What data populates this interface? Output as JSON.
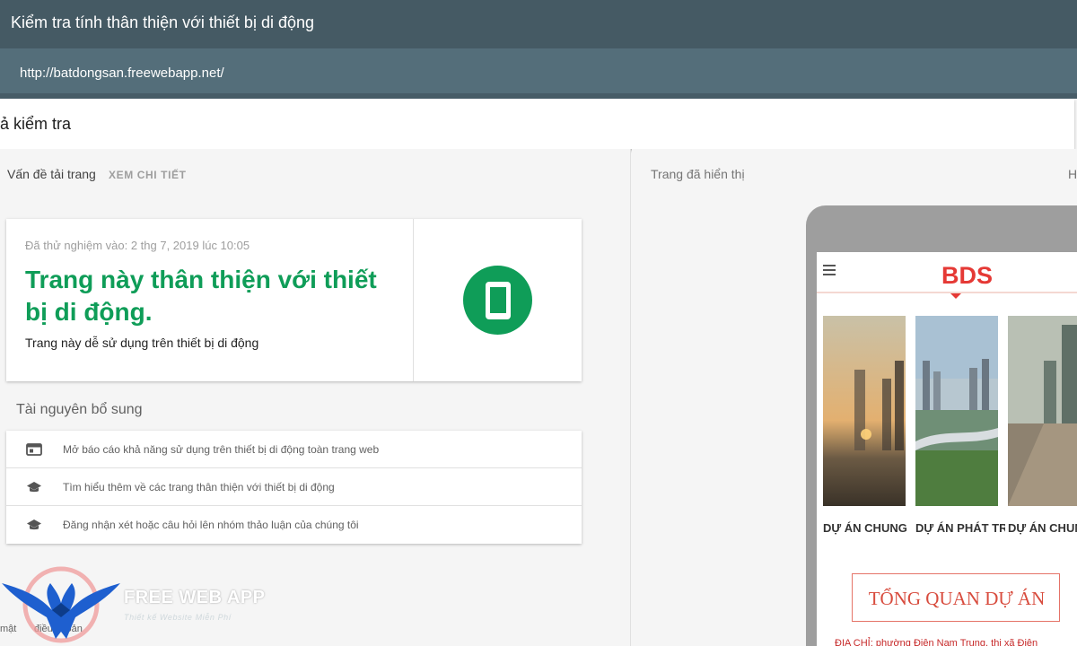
{
  "header": {
    "title": "Kiểm tra tính thân thiện với thiết bị di động",
    "url": "http://batdongsan.freewebapp.net/"
  },
  "result_header": {
    "text": "ả kiểm tra"
  },
  "left": {
    "tab_label": "Vấn đề tải trang",
    "tab_link": "XEM CHI TIẾT",
    "card": {
      "tested": "Đã thử nghiệm vào: 2 thg 7, 2019 lúc 10:05",
      "headline": "Trang này thân thiện với thiết bị di động.",
      "subtext": "Trang này dễ sử dụng trên thiết bị di động",
      "status_color": "#0f9d58",
      "icon": "smartphone-icon"
    },
    "resources_title": "Tài nguyên bổ sung",
    "resources": [
      {
        "icon": "web-page-icon",
        "label": "Mở báo cáo khả năng sử dụng trên thiết bị di động toàn trang web"
      },
      {
        "icon": "school-icon",
        "label": "Tìm hiểu thêm về các trang thân thiện với thiết bị di động"
      },
      {
        "icon": "school-icon",
        "label": "Đăng nhận xét hoặc câu hỏi lên nhóm thảo luận của chúng tôi"
      }
    ],
    "faint_footer": [
      "mật",
      "điều khoản"
    ]
  },
  "logo": {
    "brand": "FREE WEB APP",
    "tagline": "Thiết kế Website Miễn Phí"
  },
  "right": {
    "label": "Trang đã hiển thị",
    "clipped_letter": "H",
    "preview": {
      "site_logo": "BDS",
      "projects": [
        "DỰ ÁN CHUNG",
        "DỰ ÁN PHÁT TRIỂN",
        "DỰ ÁN CHUNG"
      ],
      "overview_title": "TỔNG QUAN DỰ ÁN",
      "address": "ĐỊA CHỈ: phường Điện Nam Trung, thị xã Điện"
    }
  }
}
